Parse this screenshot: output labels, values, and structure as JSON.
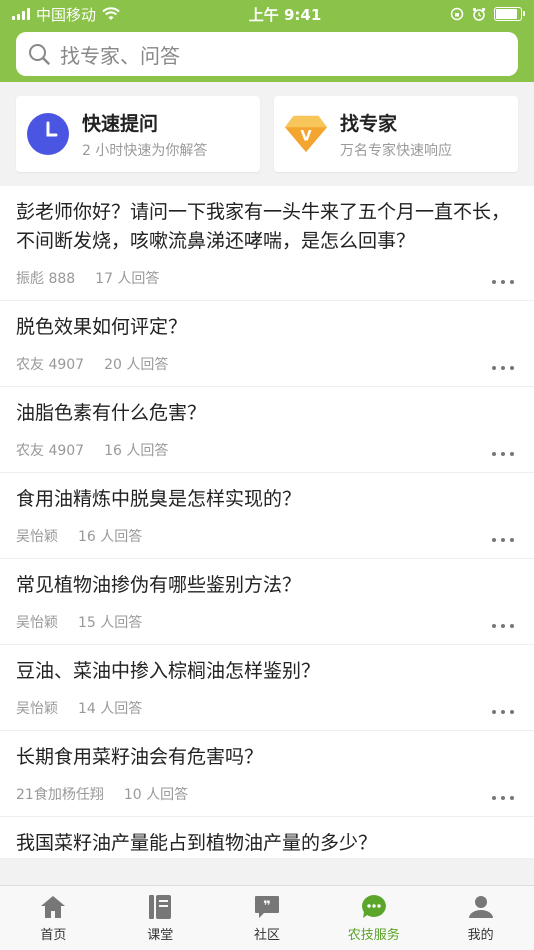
{
  "status": {
    "carrier": "中国移动",
    "time": "上午 9:41"
  },
  "search": {
    "placeholder": "找专家、问答"
  },
  "quick": [
    {
      "title": "快速提问",
      "sub": "2 小时快速为你解答",
      "icon": "clock-icon"
    },
    {
      "title": "找专家",
      "sub": "万名专家快速响应",
      "icon": "vip-diamond-icon"
    }
  ],
  "questions": [
    {
      "q": "彭老师你好？请问一下我家有一头牛来了五个月一直不长，不间断发烧，咳嗽流鼻涕还哮喘，是怎么回事？",
      "user": "振彪 888",
      "answers": "17 人回答"
    },
    {
      "q": "脱色效果如何评定？",
      "user": "农友 4907",
      "answers": "20 人回答"
    },
    {
      "q": "油脂色素有什么危害？",
      "user": "农友 4907",
      "answers": "16 人回答"
    },
    {
      "q": "食用油精炼中脱臭是怎样实现的？",
      "user": "吴怡颖",
      "answers": "16 人回答"
    },
    {
      "q": "常见植物油掺伪有哪些鉴别方法？",
      "user": "吴怡颖",
      "answers": "15 人回答"
    },
    {
      "q": "豆油、菜油中掺入棕榈油怎样鉴别？",
      "user": "吴怡颖",
      "answers": "14 人回答"
    },
    {
      "q": "长期食用菜籽油会有危害吗？",
      "user": "21食加杨任翔",
      "answers": "10 人回答"
    },
    {
      "q": "我国菜籽油产量能占到植物油产量的多少？",
      "user": "",
      "answers": ""
    }
  ],
  "tabs": [
    {
      "label": "首页"
    },
    {
      "label": "课堂"
    },
    {
      "label": "社区"
    },
    {
      "label": "农技服务"
    },
    {
      "label": "我的"
    }
  ],
  "colors": {
    "brand": "#8bc34a",
    "active_tab": "#5aa52a"
  }
}
